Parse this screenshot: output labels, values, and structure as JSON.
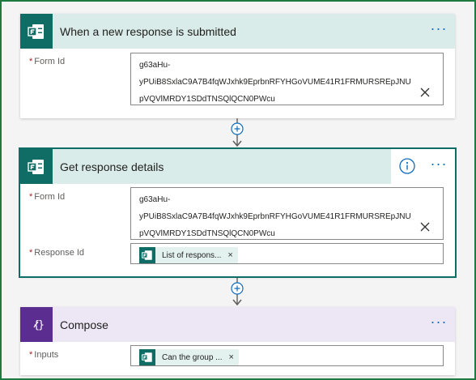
{
  "colors": {
    "forms_teal": "#0f6d66",
    "forms_header_bg": "#d9ece9",
    "compose_purple": "#5c2d91",
    "compose_header_bg": "#ece6f5",
    "link_blue": "#0f6cbd",
    "frame_green": "#1e7a3e"
  },
  "steps": [
    {
      "title": "When a new response is submitted",
      "icon": "microsoft-forms-icon",
      "more_label": "···",
      "fields": [
        {
          "label": "Form Id",
          "required_mark": "*",
          "value_lines": [
            "g63aHu-",
            "yPUiB8SxlaC9A7B4fqWJxhk9EprbnRFYHGoVUME41R1FRMURSREpJNU",
            "pVQVlMRDY1SDdTNSQlQCN0PWcu"
          ]
        }
      ]
    },
    {
      "title": "Get response details",
      "icon": "microsoft-forms-icon",
      "more_label": "···",
      "info_icon": "info-icon",
      "fields": [
        {
          "label": "Form Id",
          "required_mark": "*",
          "value_lines": [
            "g63aHu-",
            "yPUiB8SxlaC9A7B4fqWJxhk9EprbnRFYHGoVUME41R1FRMURSREpJNU",
            "pVQVlMRDY1SDdTNSQlQCN0PWcu"
          ]
        },
        {
          "label": "Response Id",
          "required_mark": "*",
          "token": {
            "label": "List of respons...",
            "remove": "×"
          }
        }
      ]
    },
    {
      "title": "Compose",
      "icon": "compose-icon",
      "more_label": "···",
      "fields": [
        {
          "label": "Inputs",
          "required_mark": "*",
          "token": {
            "label": "Can the group ...",
            "remove": "×"
          }
        }
      ]
    }
  ],
  "connectors": [
    {
      "icon": "plus-circle-icon"
    },
    {
      "icon": "plus-circle-icon"
    }
  ]
}
